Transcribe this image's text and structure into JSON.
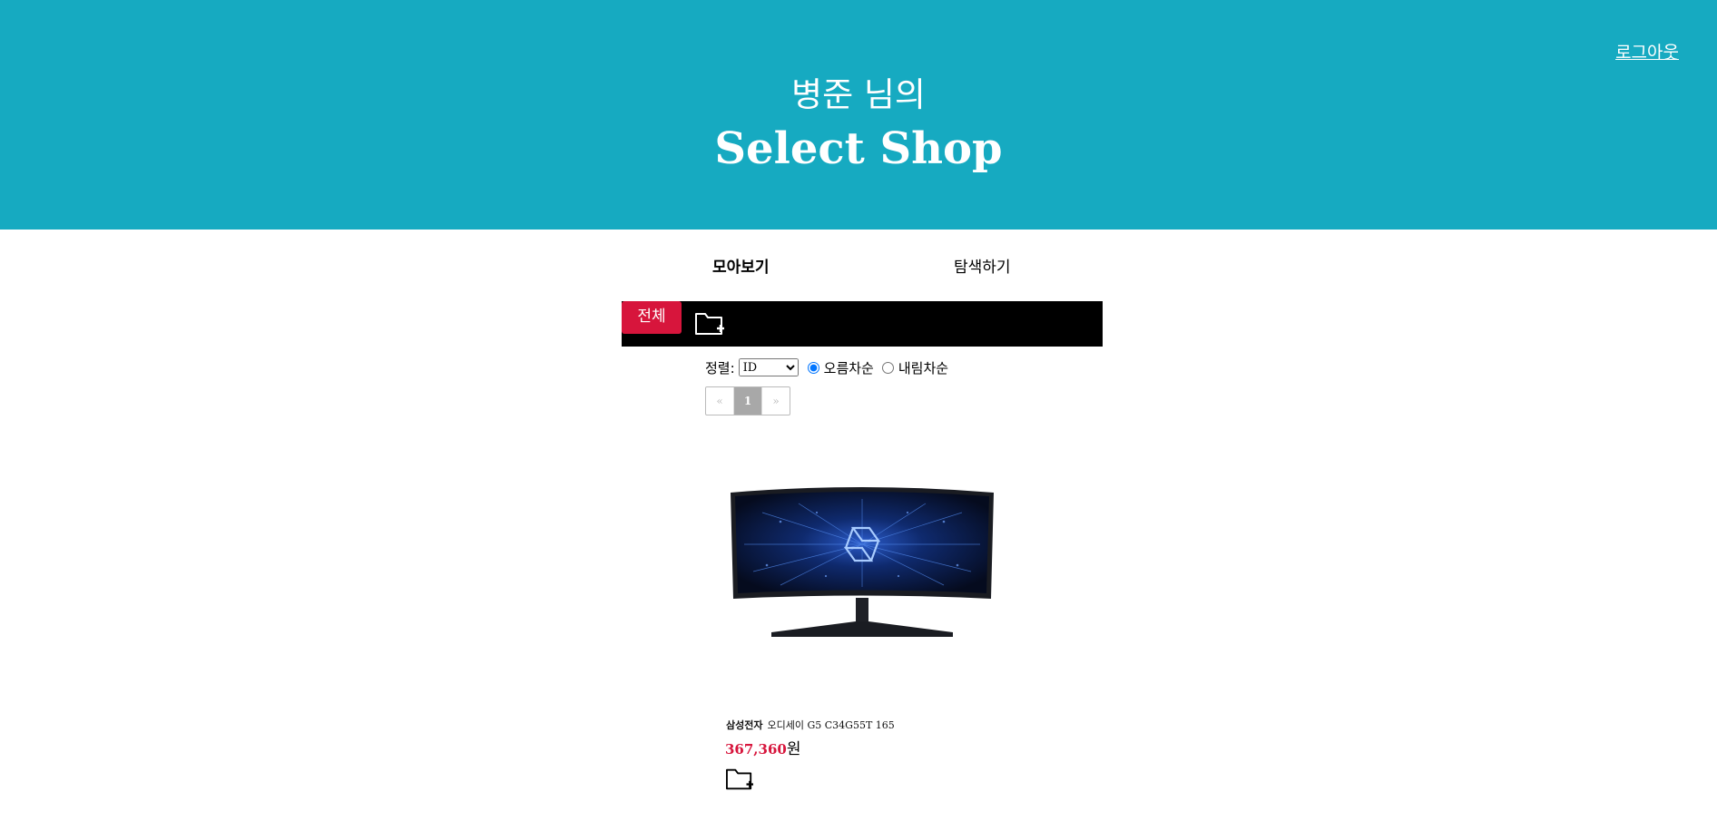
{
  "header": {
    "greeting": "병준 님의",
    "title": "Select Shop",
    "logout_label": "로그아웃",
    "background_color": "#16aac1"
  },
  "tabs": [
    {
      "label": "모아보기",
      "active": true
    },
    {
      "label": "탐색하기",
      "active": false
    }
  ],
  "folders": {
    "all_label": "전체",
    "add_icon": "folder-plus-icon"
  },
  "sort": {
    "label": "정렬:",
    "selected_option": "ID",
    "ascending_label": "오름차순",
    "descending_label": "내림차순",
    "ascending_checked": true
  },
  "pagination": {
    "prev": "«",
    "current": "1",
    "next": "»"
  },
  "product": {
    "brand": "삼성전자",
    "name": "오디세이 G5 C34G55T 165",
    "price": "367,360",
    "currency_unit": "원",
    "image_icon": "curved-monitor-image"
  },
  "colors": {
    "accent": "#d7153c",
    "bar": "#000000"
  }
}
